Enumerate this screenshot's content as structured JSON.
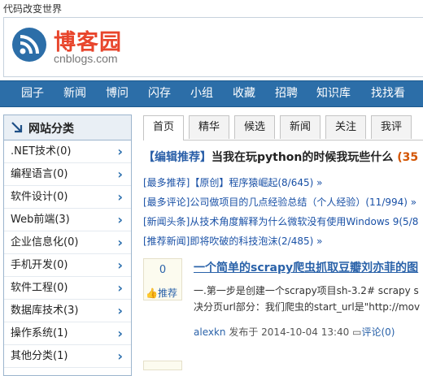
{
  "header": {
    "slogan": "代码改变世界",
    "logo_title": "博客园",
    "logo_sub": "cnblogs.com"
  },
  "nav": [
    "园子",
    "新闻",
    "博问",
    "闪存",
    "小组",
    "收藏",
    "招聘",
    "知识库",
    "找找看"
  ],
  "sidebar": {
    "title": "网站分类",
    "items": [
      ".NET技术(0)",
      "编程语言(0)",
      "软件设计(0)",
      "Web前端(3)",
      "企业信息化(0)",
      "手机开发(0)",
      "软件工程(0)",
      "数据库技术(3)",
      "操作系统(1)",
      "其他分类(1)"
    ]
  },
  "tabs": [
    "首页",
    "精华",
    "候选",
    "新闻",
    "关注",
    "我评"
  ],
  "editor_rec": {
    "bracket": "【编辑推荐】",
    "text": "当我在玩python的时候我玩些什么",
    "count": "(35"
  },
  "news_lines": [
    "[最多推荐]【原创】程序猿崛起(8/645) »",
    "[最多评论]公司做项目的几点经验总结（个人经验）(11/994) »",
    "[新闻头条]从技术角度解释为什么微软没有使用Windows 9(5/8",
    "[推荐新闻]即将吹破的科技泡沫(2/485) »"
  ],
  "post": {
    "digg_count": "0",
    "digg_label": "推荐",
    "title": "一个简单的scrapy爬虫抓取豆瓣刘亦菲的图",
    "body_line1": "一.第一步是创建一个scrapy项目sh-3.2# scrapy s",
    "body_line2": "决分页url部分：我们爬虫的start_url是\"http://mov",
    "author": "alexkn",
    "meta_text": "发布于 2014-10-04 13:40",
    "comment": "评论(0)"
  },
  "colors": {
    "nav_bg": "#2c6ea8",
    "logo_red": "#e8452c",
    "link_blue": "#1a51a6"
  }
}
